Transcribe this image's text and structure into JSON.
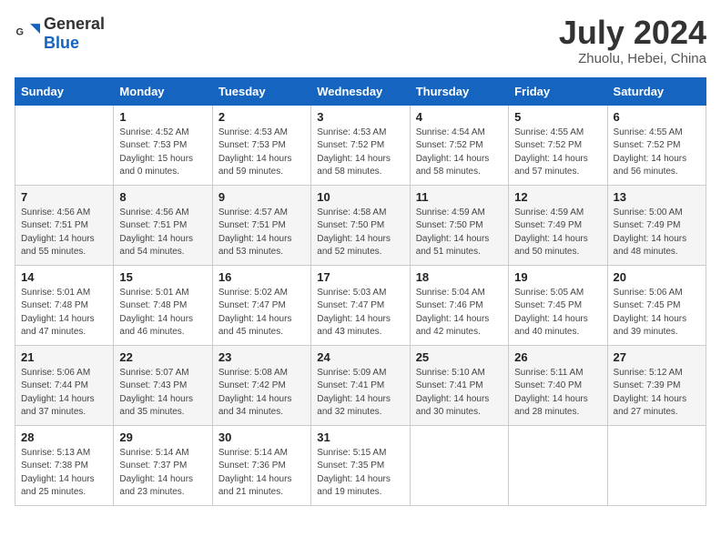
{
  "header": {
    "logo_general": "General",
    "logo_blue": "Blue",
    "month_title": "July 2024",
    "location": "Zhuolu, Hebei, China"
  },
  "weekdays": [
    "Sunday",
    "Monday",
    "Tuesday",
    "Wednesday",
    "Thursday",
    "Friday",
    "Saturday"
  ],
  "weeks": [
    [
      {
        "day": "",
        "sunrise": "",
        "sunset": "",
        "daylight": ""
      },
      {
        "day": "1",
        "sunrise": "4:52 AM",
        "sunset": "7:53 PM",
        "daylight": "15 hours and 0 minutes."
      },
      {
        "day": "2",
        "sunrise": "4:53 AM",
        "sunset": "7:53 PM",
        "daylight": "14 hours and 59 minutes."
      },
      {
        "day": "3",
        "sunrise": "4:53 AM",
        "sunset": "7:52 PM",
        "daylight": "14 hours and 58 minutes."
      },
      {
        "day": "4",
        "sunrise": "4:54 AM",
        "sunset": "7:52 PM",
        "daylight": "14 hours and 58 minutes."
      },
      {
        "day": "5",
        "sunrise": "4:55 AM",
        "sunset": "7:52 PM",
        "daylight": "14 hours and 57 minutes."
      },
      {
        "day": "6",
        "sunrise": "4:55 AM",
        "sunset": "7:52 PM",
        "daylight": "14 hours and 56 minutes."
      }
    ],
    [
      {
        "day": "7",
        "sunrise": "4:56 AM",
        "sunset": "7:51 PM",
        "daylight": "14 hours and 55 minutes."
      },
      {
        "day": "8",
        "sunrise": "4:56 AM",
        "sunset": "7:51 PM",
        "daylight": "14 hours and 54 minutes."
      },
      {
        "day": "9",
        "sunrise": "4:57 AM",
        "sunset": "7:51 PM",
        "daylight": "14 hours and 53 minutes."
      },
      {
        "day": "10",
        "sunrise": "4:58 AM",
        "sunset": "7:50 PM",
        "daylight": "14 hours and 52 minutes."
      },
      {
        "day": "11",
        "sunrise": "4:59 AM",
        "sunset": "7:50 PM",
        "daylight": "14 hours and 51 minutes."
      },
      {
        "day": "12",
        "sunrise": "4:59 AM",
        "sunset": "7:49 PM",
        "daylight": "14 hours and 50 minutes."
      },
      {
        "day": "13",
        "sunrise": "5:00 AM",
        "sunset": "7:49 PM",
        "daylight": "14 hours and 48 minutes."
      }
    ],
    [
      {
        "day": "14",
        "sunrise": "5:01 AM",
        "sunset": "7:48 PM",
        "daylight": "14 hours and 47 minutes."
      },
      {
        "day": "15",
        "sunrise": "5:01 AM",
        "sunset": "7:48 PM",
        "daylight": "14 hours and 46 minutes."
      },
      {
        "day": "16",
        "sunrise": "5:02 AM",
        "sunset": "7:47 PM",
        "daylight": "14 hours and 45 minutes."
      },
      {
        "day": "17",
        "sunrise": "5:03 AM",
        "sunset": "7:47 PM",
        "daylight": "14 hours and 43 minutes."
      },
      {
        "day": "18",
        "sunrise": "5:04 AM",
        "sunset": "7:46 PM",
        "daylight": "14 hours and 42 minutes."
      },
      {
        "day": "19",
        "sunrise": "5:05 AM",
        "sunset": "7:45 PM",
        "daylight": "14 hours and 40 minutes."
      },
      {
        "day": "20",
        "sunrise": "5:06 AM",
        "sunset": "7:45 PM",
        "daylight": "14 hours and 39 minutes."
      }
    ],
    [
      {
        "day": "21",
        "sunrise": "5:06 AM",
        "sunset": "7:44 PM",
        "daylight": "14 hours and 37 minutes."
      },
      {
        "day": "22",
        "sunrise": "5:07 AM",
        "sunset": "7:43 PM",
        "daylight": "14 hours and 35 minutes."
      },
      {
        "day": "23",
        "sunrise": "5:08 AM",
        "sunset": "7:42 PM",
        "daylight": "14 hours and 34 minutes."
      },
      {
        "day": "24",
        "sunrise": "5:09 AM",
        "sunset": "7:41 PM",
        "daylight": "14 hours and 32 minutes."
      },
      {
        "day": "25",
        "sunrise": "5:10 AM",
        "sunset": "7:41 PM",
        "daylight": "14 hours and 30 minutes."
      },
      {
        "day": "26",
        "sunrise": "5:11 AM",
        "sunset": "7:40 PM",
        "daylight": "14 hours and 28 minutes."
      },
      {
        "day": "27",
        "sunrise": "5:12 AM",
        "sunset": "7:39 PM",
        "daylight": "14 hours and 27 minutes."
      }
    ],
    [
      {
        "day": "28",
        "sunrise": "5:13 AM",
        "sunset": "7:38 PM",
        "daylight": "14 hours and 25 minutes."
      },
      {
        "day": "29",
        "sunrise": "5:14 AM",
        "sunset": "7:37 PM",
        "daylight": "14 hours and 23 minutes."
      },
      {
        "day": "30",
        "sunrise": "5:14 AM",
        "sunset": "7:36 PM",
        "daylight": "14 hours and 21 minutes."
      },
      {
        "day": "31",
        "sunrise": "5:15 AM",
        "sunset": "7:35 PM",
        "daylight": "14 hours and 19 minutes."
      },
      {
        "day": "",
        "sunrise": "",
        "sunset": "",
        "daylight": ""
      },
      {
        "day": "",
        "sunrise": "",
        "sunset": "",
        "daylight": ""
      },
      {
        "day": "",
        "sunrise": "",
        "sunset": "",
        "daylight": ""
      }
    ]
  ],
  "labels": {
    "sunrise_prefix": "Sunrise: ",
    "sunset_prefix": "Sunset: ",
    "daylight_prefix": "Daylight: "
  }
}
